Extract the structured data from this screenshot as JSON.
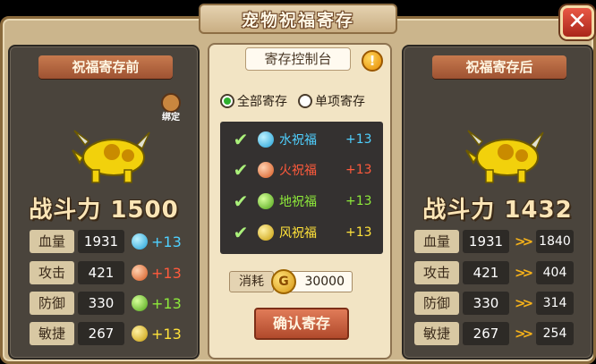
{
  "title": "宠物祝福寄存",
  "close_icon": "✕",
  "left_panel": {
    "title": "祝福寄存前",
    "bind_label": "绑定",
    "power": "战斗力 1500",
    "stats": [
      {
        "label": "血量",
        "value": "1931",
        "gem": "water",
        "bonus": "+13",
        "bonus_color": "#4fd0ff"
      },
      {
        "label": "攻击",
        "value": "421",
        "gem": "fire",
        "bonus": "+13",
        "bonus_color": "#ff5a3c"
      },
      {
        "label": "防御",
        "value": "330",
        "gem": "earth",
        "bonus": "+13",
        "bonus_color": "#8eea3a"
      },
      {
        "label": "敏捷",
        "value": "267",
        "gem": "wind",
        "bonus": "+13",
        "bonus_color": "#ffe23a"
      }
    ]
  },
  "middle_panel": {
    "tab": "寄存控制台",
    "warning_icon": "!",
    "radio_all": "全部寄存",
    "radio_single": "单项寄存",
    "blessings": [
      {
        "name": "水祝福",
        "bonus": "+13",
        "color": "#4fd0ff",
        "gem": "water"
      },
      {
        "name": "火祝福",
        "bonus": "+13",
        "color": "#ff5a3c",
        "gem": "fire"
      },
      {
        "name": "地祝福",
        "bonus": "+13",
        "color": "#8eea3a",
        "gem": "earth"
      },
      {
        "name": "风祝福",
        "bonus": "+13",
        "color": "#ffe23a",
        "gem": "wind"
      }
    ],
    "cost_label": "消耗",
    "cost_value": "30000",
    "coin_glyph": "G",
    "confirm": "确认寄存"
  },
  "right_panel": {
    "title": "祝福寄存后",
    "power": "战斗力 1432",
    "stats": [
      {
        "label": "血量",
        "value": "1931",
        "new_value": "1840"
      },
      {
        "label": "攻击",
        "value": "421",
        "new_value": "404"
      },
      {
        "label": "防御",
        "value": "330",
        "new_value": "314"
      },
      {
        "label": "敏捷",
        "value": "267",
        "new_value": "254"
      }
    ]
  }
}
